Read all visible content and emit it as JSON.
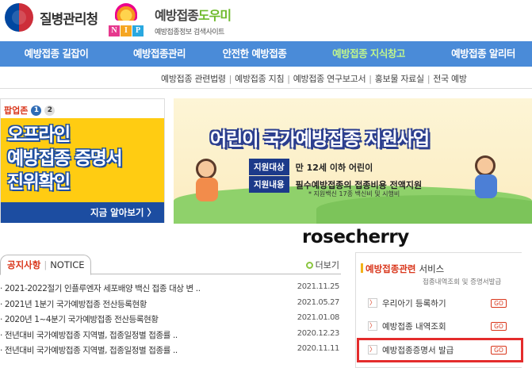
{
  "header": {
    "org_name": "질병관리청",
    "nip_letters": [
      "N",
      "I",
      "P"
    ],
    "site_title_main": "예방접종",
    "site_title_accent": "도우미",
    "site_subtitle": "예방접종정보 검색사이트"
  },
  "gnb": {
    "items": [
      {
        "label": "예방접종 길잡이"
      },
      {
        "label": "예방접종관리"
      },
      {
        "label": "안전한 예방접종"
      },
      {
        "label": "예방접종 지식창고"
      },
      {
        "label": "예방접종 알리터"
      }
    ],
    "active_index": 3,
    "active_color": "#bff58d",
    "bg_color": "#4a8bd8"
  },
  "subnav": {
    "items": [
      "예방접종 관련법령",
      "예방접종 지침",
      "예방접종 연구보고서",
      "홍보물 자료실",
      "전국 예방"
    ]
  },
  "popup": {
    "label": "팝업존",
    "pages": [
      "1",
      "2"
    ],
    "banner_lines": [
      "오프라인",
      "예방접종 증명서",
      "진위확인"
    ],
    "more_label": "지금 알아보기 〉"
  },
  "hero": {
    "title": "어린이 국가예방접종 지원사업",
    "rows": [
      {
        "tag": "지원대상",
        "text": "만 12세 이하 어린이"
      },
      {
        "tag": "지원내용",
        "text": "필수예방접종의 접종비용 전액지원"
      }
    ],
    "note": "* 지원백신 17종 백신비 및 시행비"
  },
  "watermark": "rosecherry",
  "notice": {
    "tab_label": "공지사항",
    "tab_label_en": "NOTICE",
    "more_label": "더보기",
    "items": [
      {
        "title": "· 2021-2022절기 인플루엔자 세포배양 백신 접종 대상 변 ..",
        "date": "2021.11.25"
      },
      {
        "title": "· 2021년 1분기 국가예방접종 전산등록현황",
        "date": "2021.05.27"
      },
      {
        "title": "· 2020년 1~4분기 국가예방접종 전산등록현황",
        "date": "2021.01.08"
      },
      {
        "title": "· 전년대비 국가예방접종 지역별, 접종일정별 접종률 ..",
        "date": "2020.12.23"
      },
      {
        "title": "· 전년대비 국가예방접종 지역별, 접종일정별 접종률 ..",
        "date": "2020.11.11"
      }
    ]
  },
  "services": {
    "title_accent": "예방접종관련",
    "title_rest": "서비스",
    "subtitle": "접종내역조회 및 증명서발급",
    "items": [
      {
        "label": "우리아기 등록하기",
        "go": "GO"
      },
      {
        "label": "예방접종 내역조회",
        "go": "GO"
      },
      {
        "label": "예방접종증명서 발급",
        "go": "GO"
      }
    ],
    "highlight_color": "#e42c2c"
  }
}
